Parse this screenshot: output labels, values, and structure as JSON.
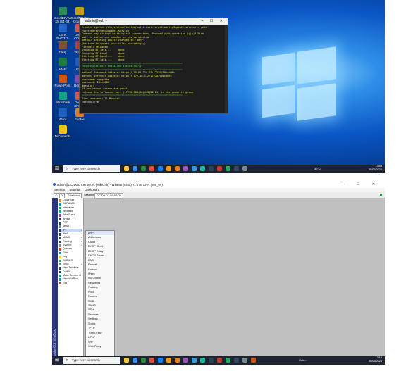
{
  "screenshot1": {
    "desktop_icons": [
      {
        "label": "CorelDRAW X8 (64-Bit)",
        "color": "#2e8b57"
      },
      {
        "label": "CorelDRAW Graphics",
        "color": "#c4a000"
      },
      {
        "label": "Corel PHOTO-PAINT",
        "color": "#2266cc"
      },
      {
        "label": "Google Chrome",
        "color": "#e74c3c"
      },
      {
        "label": "Putty",
        "color": "#7a5230"
      },
      {
        "label": "WinBox",
        "color": "#c0392b"
      },
      {
        "label": "Excel",
        "color": "#1e7a3e"
      },
      {
        "label": "Word",
        "color": "#1f5fbf"
      },
      {
        "label": "PowerPoint",
        "color": "#d35400"
      },
      {
        "label": "Remote",
        "color": "#8e44ad"
      },
      {
        "label": "Wireshark",
        "color": "#16a085"
      },
      {
        "label": "Google Chrome",
        "color": "#e74c3c"
      },
      {
        "label": "Word",
        "color": "#1f5fbf"
      },
      {
        "label": "Firefox",
        "color": "#e67e22"
      },
      {
        "label": "Documents",
        "color": "#f1c40f"
      }
    ],
    "terminal": {
      "title": "admin@vul: ~",
      "lines": [
        {
          "t": "Created symlink /etc/systemd/system/multi-user.target.wants/3xpanel.service → /etc",
          "c": "y"
        },
        {
          "t": "/systemd/system/3xpanel.service.",
          "c": "y"
        },
        {
          "t": "Command may disrupt existing ssh connections. Proceed with operation (y|n)? Fire",
          "c": "y"
        },
        {
          "t": "wall is active and enabled on system startup",
          "c": "y"
        },
        {
          "t": "Default incoming policy changed to 'deny'",
          "c": "y"
        },
        {
          "t": "(be sure to update your rules accordingly)",
          "c": "y"
        },
        {
          "t": "Firewall reloaded",
          "c": "y"
        },
        {
          "t": "Stopping BT-Task...     done",
          "c": "y"
        },
        {
          "t": "Stopping BT-Panel...    done",
          "c": "y"
        },
        {
          "t": "Starting BT-Panel...    done",
          "c": "y"
        },
        {
          "t": "Starting BT-Task...     done",
          "c": "y"
        },
        {
          "t": "==================================================================",
          "c": "g"
        },
        {
          "t": "Congratulations! Installed successfully!",
          "c": "g"
        },
        {
          "t": "==================================================================",
          "c": "g"
        },
        {
          "t": "aaPanel Internet Address: https://35.65.124.67:17270/90bcdd6c",
          "c": "y"
        },
        {
          "t": "aaPanel Internal Address: https://172.16.1.2:17270/90bcdd6c",
          "c": "y"
        },
        {
          "t": "username: ngpqyhhm",
          "c": "y"
        },
        {
          "t": "password: 234ca081",
          "c": "y"
        },
        {
          "t": "Warning:",
          "c": "y"
        },
        {
          "t": "If you cannot access the panel,",
          "c": "y"
        },
        {
          "t": "release the following port (17270|888|80|443|20|21) in the security group",
          "c": "y"
        },
        {
          "t": "==================================================================",
          "c": "g"
        },
        {
          "t": "Time consumed: 11 Minute!",
          "c": "y"
        },
        {
          "t": "root@vul:~# ",
          "c": "w"
        }
      ]
    },
    "taskbar": {
      "search_placeholder": "Type here to search",
      "weather": "32°C",
      "time": "13:08",
      "date": "30/09/2024",
      "icon_colors": [
        "#ffc83d",
        "#3a8ee6",
        "#2b8a3e",
        "#e74c3c",
        "#0a84ff",
        "#f39c12",
        "#e67e22",
        "#9b59b6",
        "#3498db",
        "#1abc9c",
        "#2c3e50",
        "#c0392b",
        "#27ae60",
        "#34495e",
        "#7f8c8d"
      ]
    }
  },
  "screenshot2": {
    "window_title": "admin@DC:D0:D7:97:00:04 (MikroTik) - WinBox (64bit) v7.8 on CHR (x86_64)",
    "menu": [
      "Session",
      "Settings",
      "Dashboard"
    ],
    "toolbar": {
      "safe_mode": "Safe Mode",
      "session_label": "Session:",
      "session_value": "DC:D0:D7:97:00:04"
    },
    "brand_vertical": "RouterOS WinBox",
    "sidebar": [
      {
        "label": "Quick Set",
        "color": "#e67e22",
        "arrow": false
      },
      {
        "label": "CAPsMAN",
        "color": "#2980b9",
        "arrow": false
      },
      {
        "label": "Interfaces",
        "color": "#27ae60",
        "arrow": false
      },
      {
        "label": "Wireless",
        "color": "#16a085",
        "arrow": false
      },
      {
        "label": "WireGuard",
        "color": "#8e44ad",
        "arrow": false
      },
      {
        "label": "Bridge",
        "color": "#2c3e50",
        "arrow": false
      },
      {
        "label": "PPP",
        "color": "#2c3e50",
        "arrow": false
      },
      {
        "label": "Mesh",
        "color": "#7f8c8d",
        "arrow": false
      },
      {
        "label": "IP",
        "color": "#2c3e50",
        "arrow": true
      },
      {
        "label": "IPv6",
        "color": "#2c3e50",
        "arrow": true
      },
      {
        "label": "MPLS",
        "color": "#2c3e50",
        "arrow": true
      },
      {
        "label": "Routing",
        "color": "#2c3e50",
        "arrow": true
      },
      {
        "label": "System",
        "color": "#7f8c8d",
        "arrow": true
      },
      {
        "label": "Queues",
        "color": "#c0392b",
        "arrow": false
      },
      {
        "label": "Files",
        "color": "#2980b9",
        "arrow": false
      },
      {
        "label": "Log",
        "color": "#f1c40f",
        "arrow": false
      },
      {
        "label": "RADIUS",
        "color": "#27ae60",
        "arrow": false
      },
      {
        "label": "Tools",
        "color": "#7f8c8d",
        "arrow": true
      },
      {
        "label": "New Terminal",
        "color": "#2c3e50",
        "arrow": false
      },
      {
        "label": "Dot1X",
        "color": "#2c3e50",
        "arrow": false
      },
      {
        "label": "Make Supout.rif",
        "color": "#16a085",
        "arrow": false
      },
      {
        "label": "New WinBox",
        "color": "#2980b9",
        "arrow": false
      },
      {
        "label": "Exit",
        "color": "#c0392b",
        "arrow": false
      }
    ],
    "selected_sidebar_index": 8,
    "submenu": [
      "ARP",
      "Addresses",
      "Cloud",
      "DHCP Client",
      "DHCP Relay",
      "DHCP Server",
      "DNS",
      "Firewall",
      "Hotspot",
      "IPsec",
      "Kid Control",
      "Neighbors",
      "Packing",
      "Pool",
      "Routes",
      "SMB",
      "SNMP",
      "SSH",
      "Services",
      "Settings",
      "Socks",
      "TFTP",
      "Traffic Flow",
      "UPnP",
      "VRF",
      "Web Proxy"
    ],
    "taskbar": {
      "search_placeholder": "Type here to search",
      "app_label": "Cula...",
      "time": "13:15",
      "date": "30/09/2024",
      "icon_colors": [
        "#ffc83d",
        "#3a8ee6",
        "#2b8a3e",
        "#e74c3c",
        "#0a84ff",
        "#f39c12",
        "#e67e22",
        "#9b59b6",
        "#3498db",
        "#1abc9c",
        "#2c3e50",
        "#c0392b",
        "#27ae60",
        "#34495e",
        "#7f8c8d",
        "#d35400"
      ]
    }
  }
}
